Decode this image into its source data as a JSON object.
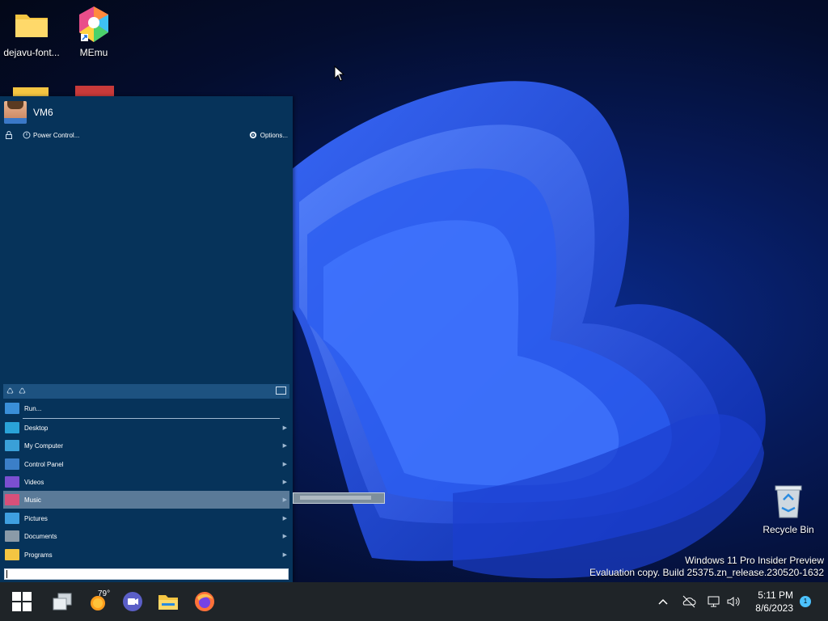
{
  "desktop": {
    "icons": [
      {
        "label": "dejavu-font..."
      },
      {
        "label": "MEmu"
      },
      {
        "label": "Recycle Bin"
      }
    ],
    "watermark": {
      "line1": "Windows 11 Pro Insider Preview",
      "line2": "Evaluation copy. Build 25375.zn_release.230520-1632"
    }
  },
  "start_menu": {
    "username": "VM6",
    "power_control_label": "Power Control...",
    "options_label": "Options...",
    "run_label": "Run...",
    "items": [
      {
        "label": "Desktop",
        "icon": "desktop-icon",
        "color": "#2aa3d8"
      },
      {
        "label": "My Computer",
        "icon": "computer-icon",
        "color": "#3aa0d8"
      },
      {
        "label": "Control Panel",
        "icon": "control-panel-icon",
        "color": "#3b7fc8"
      },
      {
        "label": "Videos",
        "icon": "videos-icon",
        "color": "#7b4fd0"
      },
      {
        "label": "Music",
        "icon": "music-icon",
        "color": "#d8507a"
      },
      {
        "label": "Pictures",
        "icon": "pictures-icon",
        "color": "#3f9fe0"
      },
      {
        "label": "Documents",
        "icon": "documents-icon",
        "color": "#8a9aa8"
      },
      {
        "label": "Programs",
        "icon": "folder-icon",
        "color": "#f4c542"
      }
    ],
    "active_item": "Music",
    "search_value": ""
  },
  "taskbar": {
    "weather_temp": "79°",
    "clock_time": "5:11 PM",
    "clock_date": "8/6/2023",
    "notification_count": "1",
    "apps": [
      "start-icon",
      "task-view-icon",
      "weather-icon",
      "meet-icon",
      "file-explorer-icon",
      "firefox-icon"
    ]
  },
  "colors": {
    "start_menu_bg": "#06335a",
    "taskbar_bg": "#1f2428",
    "accent": "#4cc2ff"
  }
}
